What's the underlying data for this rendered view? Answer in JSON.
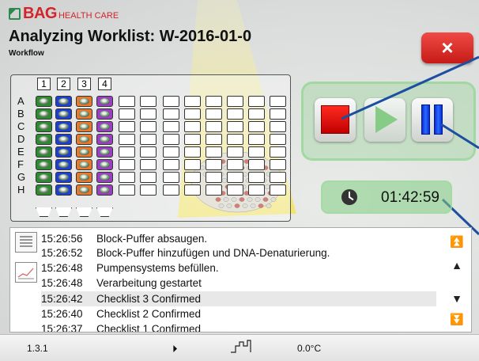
{
  "brand": {
    "name": "BAG",
    "tagline": "HEALTH CARE"
  },
  "header": {
    "title": "Analyzing Worklist: W-2016-01-0",
    "subtitle": "Workflow"
  },
  "close_label": "×",
  "plate": {
    "column_numbers": [
      "1",
      "2",
      "3",
      "4"
    ],
    "row_labels": [
      "A",
      "B",
      "C",
      "D",
      "E",
      "F",
      "G",
      "H"
    ],
    "filled_column_colors": [
      "#2e8b2e",
      "#1f3fd1",
      "#e8782a",
      "#9a3fc4"
    ]
  },
  "controls": {
    "stop": "stop",
    "play": "play",
    "pause": "pause"
  },
  "timer": {
    "value": "01:42:59"
  },
  "log": {
    "entries": [
      {
        "time": "15:26:56",
        "message": "Block-Puffer absaugen."
      },
      {
        "time": "15:26:52",
        "message": "Block-Puffer hinzufügen und DNA-Denaturierung."
      },
      {
        "time": "15:26:48",
        "message": "Pumpensystems befüllen."
      },
      {
        "time": "15:26:48",
        "message": "Verarbeitung gestartet"
      },
      {
        "time": "15:26:42",
        "message": "Checklist 3 Confirmed"
      },
      {
        "time": "15:26:40",
        "message": "Checklist 2 Confirmed"
      },
      {
        "time": "15:26:37",
        "message": "Checklist 1 Confirmed"
      }
    ]
  },
  "status_bar": {
    "version": "1.3.1",
    "temperature": "0.0°C"
  }
}
